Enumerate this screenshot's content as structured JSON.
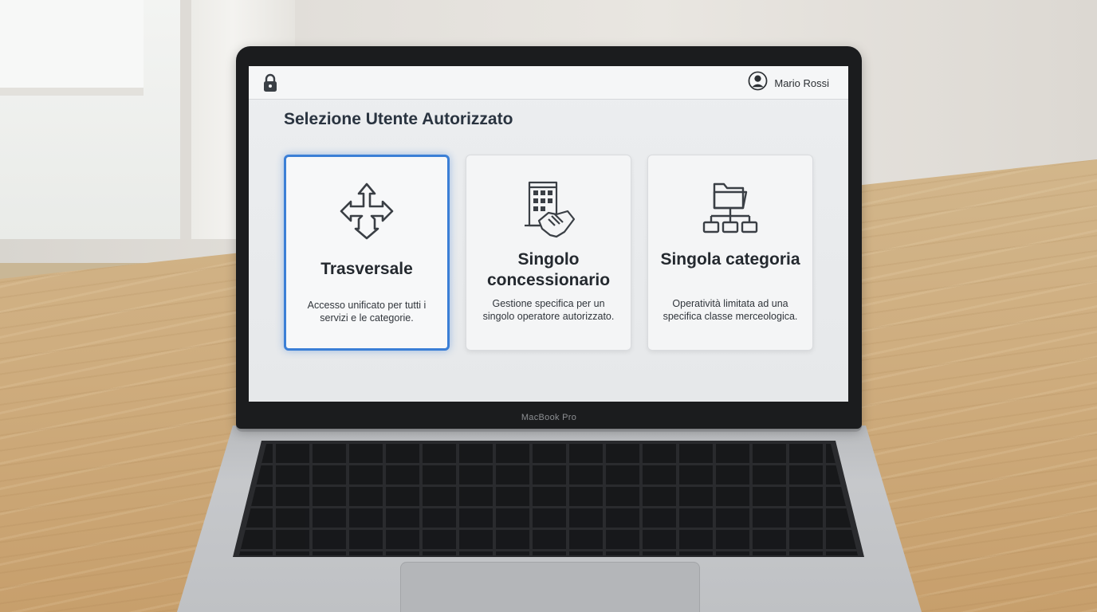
{
  "laptop": {
    "brand": "MacBook Pro"
  },
  "topbar": {
    "lock_icon": "lock-icon",
    "user_icon": "user-circle-icon",
    "user_name": "Mario Rossi"
  },
  "page": {
    "title": "Selezione Utente Autorizzato"
  },
  "cards": [
    {
      "icon": "four-way-arrows-icon",
      "title": "Trasversale",
      "description": "Accesso unificato per tutti i servizi e le categorie.",
      "selected": true
    },
    {
      "icon": "building-handshake-icon",
      "title": "Singolo concessionario",
      "description": "Gestione specifica per un singolo operatore autorizzato.",
      "selected": false
    },
    {
      "icon": "folder-hierarchy-icon",
      "title": "Singola categoria",
      "description": "Operatività limitata ad una specifica classe merceologica.",
      "selected": false
    }
  ],
  "colors": {
    "selection_accent": "#3b7fd6",
    "title_text": "#2a3440"
  }
}
